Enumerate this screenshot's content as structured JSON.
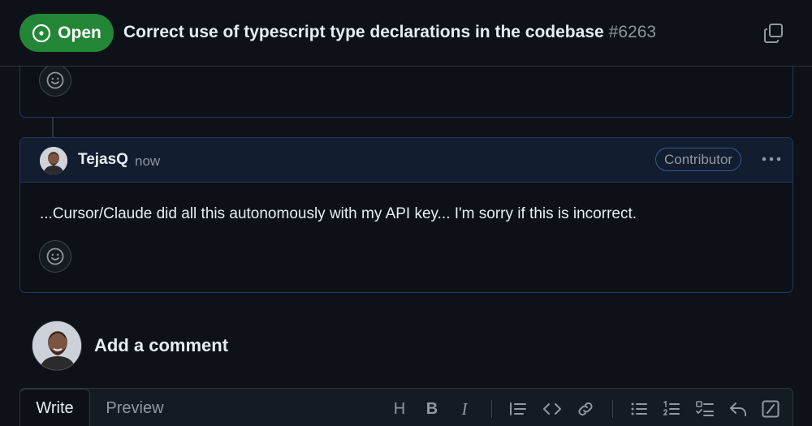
{
  "header": {
    "status": "Open",
    "title": "Correct use of typescript type declarations in the codebase",
    "number": "#6263",
    "status_color": "#238636"
  },
  "comment": {
    "author": "TejasQ",
    "time": "now",
    "role": "Contributor",
    "body": "...Cursor/Claude did all this autonomously with my API key... I'm sorry if this is incorrect."
  },
  "add_comment": {
    "title": "Add a comment"
  },
  "editor": {
    "tabs": [
      "Write",
      "Preview"
    ],
    "active_tab": "Write",
    "toolbar": {
      "heading": "H",
      "bold": "B",
      "italic": "I"
    },
    "toolbar_icons": [
      "heading-icon",
      "bold-icon",
      "italic-icon",
      "quote-icon",
      "code-icon",
      "link-icon",
      "bulleted-list-icon",
      "numbered-list-icon",
      "task-list-icon",
      "reply-icon",
      "slash-command-icon"
    ]
  },
  "colors": {
    "accent_border": "#1f3a5c",
    "header_tint": "#121d2f",
    "background": "#0e1117"
  }
}
